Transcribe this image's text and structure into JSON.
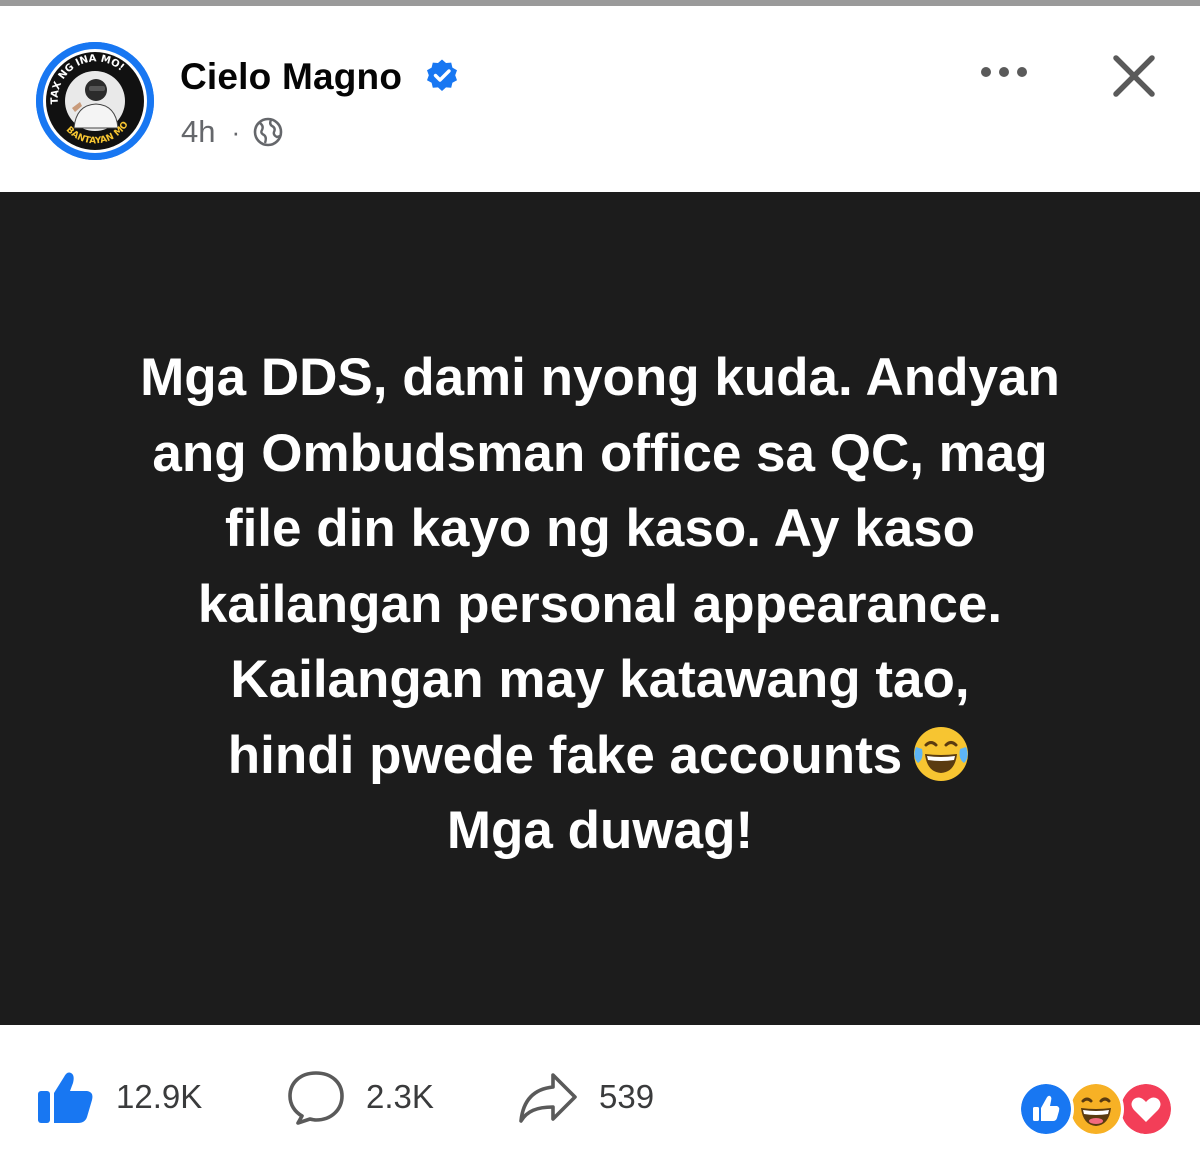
{
  "post": {
    "author": "Cielo Magno",
    "time": "4h",
    "separator": "·",
    "avatar_text": {
      "top": "TAX NG INA MO!",
      "bottom": "BANTAYAN MO!"
    },
    "content_lines": [
      "Mga DDS, dami nyong kuda. Andyan",
      "ang Ombudsman office sa QC, mag",
      "file din kayo ng kaso. Ay kaso",
      "kailangan personal appearance.",
      "Kailangan may katawang tao,",
      "hindi pwede fake accounts",
      "Mga duwag!"
    ]
  },
  "footer": {
    "likes": "12.9K",
    "comments": "2.3K",
    "shares": "539"
  },
  "colors": {
    "brand_blue": "#1877f2",
    "card_bg": "#1c1c1c",
    "love_red": "#f33e58",
    "haha_yellow": "#f7b125"
  },
  "icons": [
    "verified-badge-icon",
    "globe-icon",
    "more-options-icon",
    "close-icon",
    "like-icon",
    "comment-icon",
    "share-icon",
    "tears-of-joy-emoji-icon",
    "like-reaction-icon",
    "haha-reaction-icon",
    "love-reaction-icon"
  ]
}
